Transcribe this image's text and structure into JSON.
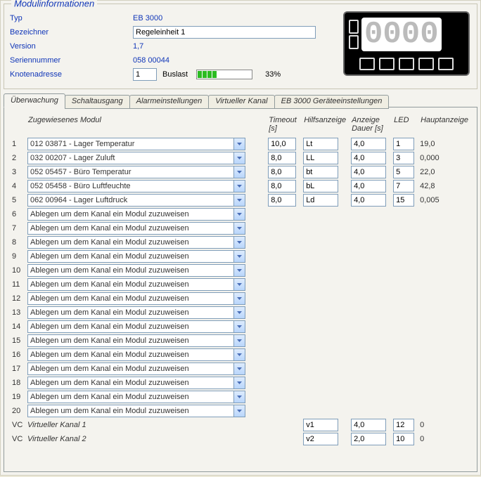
{
  "legend": "Modulinformationen",
  "labels": {
    "typ": "Typ",
    "bezeichner": "Bezeichner",
    "version": "Version",
    "seriennummer": "Seriennummer",
    "knotenadresse": "Knotenadresse",
    "buslast": "Buslast"
  },
  "values": {
    "typ": "EB 3000",
    "bezeichner": "Regeleinheit 1",
    "version": "1,7",
    "seriennummer": "058 00044",
    "knotenadresse": "1",
    "buslast_pct": "33%"
  },
  "lcd": {
    "small": "00",
    "big": "0000"
  },
  "tabs": {
    "ueberwachung": "Überwachung",
    "schaltausgang": "Schaltausgang",
    "alarm": "Alarmeinstellungen",
    "vkanal": "Virtueller Kanal",
    "geraet": "EB 3000 Geräteeinstellungen"
  },
  "headers": {
    "modul": "Zugewiesenes Modul",
    "timeout": "Timeout [s]",
    "hilfs": "Hilfsanzeige",
    "dauer": "Anzeige Dauer [s]",
    "led": "LED",
    "haupt": "Hauptanzeige"
  },
  "placeholder_text": "Ablegen um dem Kanal ein Modul zuzuweisen",
  "rows": [
    {
      "n": "1",
      "modul": "012 03871 - Lager Temperatur",
      "timeout": "10,0",
      "hilfs": "Lt",
      "dauer": "4,0",
      "led": "1",
      "haupt": "19,0"
    },
    {
      "n": "2",
      "modul": "032 00207 - Lager Zuluft",
      "timeout": "8,0",
      "hilfs": "LL",
      "dauer": "4,0",
      "led": "3",
      "haupt": "0,000"
    },
    {
      "n": "3",
      "modul": "052 05457 - Büro Temperatur",
      "timeout": "8,0",
      "hilfs": "bt",
      "dauer": "4,0",
      "led": "5",
      "haupt": "22,0"
    },
    {
      "n": "4",
      "modul": "052 05458 - Büro Luftfeuchte",
      "timeout": "8,0",
      "hilfs": "bL",
      "dauer": "4,0",
      "led": "7",
      "haupt": "42,8"
    },
    {
      "n": "5",
      "modul": "062 00964 - Lager Luftdruck",
      "timeout": "8,0",
      "hilfs": "Ld",
      "dauer": "4,0",
      "led": "15",
      "haupt": "0,005"
    },
    {
      "n": "6",
      "modul": "",
      "timeout": "",
      "hilfs": "",
      "dauer": "",
      "led": "",
      "haupt": ""
    },
    {
      "n": "7",
      "modul": "",
      "timeout": "",
      "hilfs": "",
      "dauer": "",
      "led": "",
      "haupt": ""
    },
    {
      "n": "8",
      "modul": "",
      "timeout": "",
      "hilfs": "",
      "dauer": "",
      "led": "",
      "haupt": ""
    },
    {
      "n": "9",
      "modul": "",
      "timeout": "",
      "hilfs": "",
      "dauer": "",
      "led": "",
      "haupt": ""
    },
    {
      "n": "10",
      "modul": "",
      "timeout": "",
      "hilfs": "",
      "dauer": "",
      "led": "",
      "haupt": ""
    },
    {
      "n": "11",
      "modul": "",
      "timeout": "",
      "hilfs": "",
      "dauer": "",
      "led": "",
      "haupt": ""
    },
    {
      "n": "12",
      "modul": "",
      "timeout": "",
      "hilfs": "",
      "dauer": "",
      "led": "",
      "haupt": ""
    },
    {
      "n": "13",
      "modul": "",
      "timeout": "",
      "hilfs": "",
      "dauer": "",
      "led": "",
      "haupt": ""
    },
    {
      "n": "14",
      "modul": "",
      "timeout": "",
      "hilfs": "",
      "dauer": "",
      "led": "",
      "haupt": ""
    },
    {
      "n": "15",
      "modul": "",
      "timeout": "",
      "hilfs": "",
      "dauer": "",
      "led": "",
      "haupt": ""
    },
    {
      "n": "16",
      "modul": "",
      "timeout": "",
      "hilfs": "",
      "dauer": "",
      "led": "",
      "haupt": ""
    },
    {
      "n": "17",
      "modul": "",
      "timeout": "",
      "hilfs": "",
      "dauer": "",
      "led": "",
      "haupt": ""
    },
    {
      "n": "18",
      "modul": "",
      "timeout": "",
      "hilfs": "",
      "dauer": "",
      "led": "",
      "haupt": ""
    },
    {
      "n": "19",
      "modul": "",
      "timeout": "",
      "hilfs": "",
      "dauer": "",
      "led": "",
      "haupt": ""
    },
    {
      "n": "20",
      "modul": "",
      "timeout": "",
      "hilfs": "",
      "dauer": "",
      "led": "",
      "haupt": ""
    }
  ],
  "vc_label": "VC",
  "vc": [
    {
      "label": "Virtueller Kanal 1",
      "hilfs": "v1",
      "dauer": "4,0",
      "led": "12",
      "haupt": "0"
    },
    {
      "label": "Virtueller Kanal 2",
      "hilfs": "v2",
      "dauer": "2,0",
      "led": "10",
      "haupt": "0"
    }
  ]
}
